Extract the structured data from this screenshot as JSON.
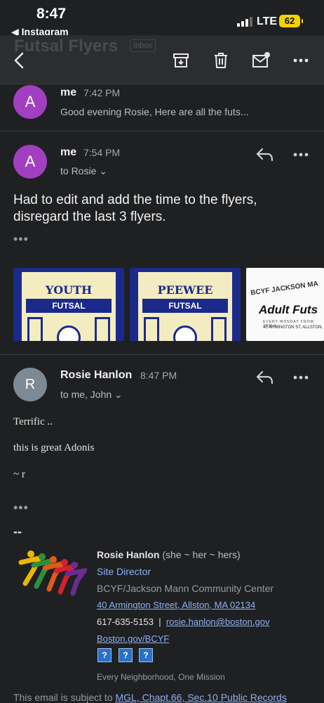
{
  "status": {
    "time": "8:47",
    "back_app": "◀ Instagram",
    "network": "LTE",
    "battery": "62"
  },
  "toolbar": {
    "subject": "Futsal Flyers",
    "label_badge": "Inbox"
  },
  "messages": [
    {
      "avatar": "A",
      "avatar_color": "#a23fc1",
      "sender": "me",
      "time": "7:42 PM",
      "snippet": "Good evening Rosie, Here are all the futs..."
    },
    {
      "avatar": "A",
      "avatar_color": "#a23fc1",
      "sender": "me",
      "time": "7:54 PM",
      "recipients": "to Rosie ⌄",
      "body": "Had to edit and add the time to the flyers, disregard the last 3 flyers.",
      "more": "•••",
      "attachments": [
        {
          "title": "YOUTH",
          "band": "FUTSAL"
        },
        {
          "title": "PEEWEE",
          "band": "FUTSAL"
        },
        {
          "arc": "BCYF JACKSON MA",
          "title": "Adult Futs",
          "line1": "EVERY MONDAY FROM 7PM-9",
          "line2": "40 ARMINGTON ST, ALLSTON,"
        }
      ]
    },
    {
      "avatar": "R",
      "avatar_color": "#7d8a93",
      "sender": "Rosie Hanlon",
      "time": "8:47 PM",
      "recipients": "to me, John ⌄",
      "lines": [
        "Terrific ..",
        "this is great Adonis",
        "~ r"
      ],
      "more": "•••"
    }
  ],
  "signature": {
    "separator": "--",
    "name": "Rosie Hanlon",
    "pronouns": "(she ~ her ~ hers)",
    "title": "Site Director",
    "org": "BCYF/Jackson Mann Community Center",
    "address": "40 Armington Street, Allston, MA 02134",
    "phone": "617-635-5153",
    "divider": "|",
    "email": "rosie.hanlon@boston.gov",
    "website": "Boston.gov/BCYF",
    "social": [
      "?",
      "?",
      "?"
    ],
    "tagline": "Every Neighborhood, One Mission"
  },
  "footer": {
    "prefix": "This email is subject to ",
    "link": "MGL, Chapt.66, Sec.10 Public Records"
  },
  "colors": {
    "background": "#1f2022",
    "link": "#8fb0f0",
    "accent_avatar": "#a23fc1"
  }
}
